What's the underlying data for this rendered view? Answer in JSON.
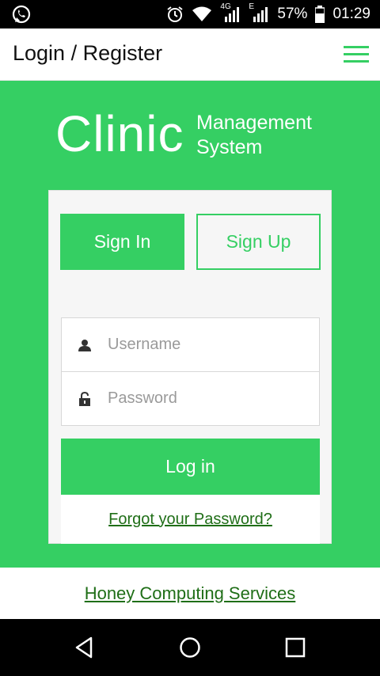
{
  "status_bar": {
    "network": "4G",
    "network2": "E",
    "battery": "57%",
    "time": "01:29"
  },
  "app_bar": {
    "title": "Login / Register"
  },
  "brand": {
    "main": "Clinic",
    "sub_line1": "Management",
    "sub_line2": "System"
  },
  "tabs": {
    "signin_label": "Sign In",
    "signup_label": "Sign Up"
  },
  "form": {
    "username_placeholder": "Username",
    "username_value": "",
    "password_placeholder": "Password",
    "password_value": "",
    "login_label": "Log in",
    "forgot_label": "Forgot your Password?"
  },
  "footer": {
    "link_label": "Honey Computing Services"
  },
  "colors": {
    "accent": "#35cf63",
    "link": "#1f6e17",
    "card_bg": "#f6f6f6"
  },
  "icons": {
    "status_left": "whatsapp-icon",
    "alarm": "alarm-icon",
    "wifi": "wifi-icon",
    "signal": "signal-icon",
    "battery": "battery-icon",
    "menu": "menu-icon",
    "user": "user-icon",
    "lock": "lock-icon",
    "back": "back-icon",
    "home": "home-icon",
    "recent": "recent-apps-icon"
  }
}
